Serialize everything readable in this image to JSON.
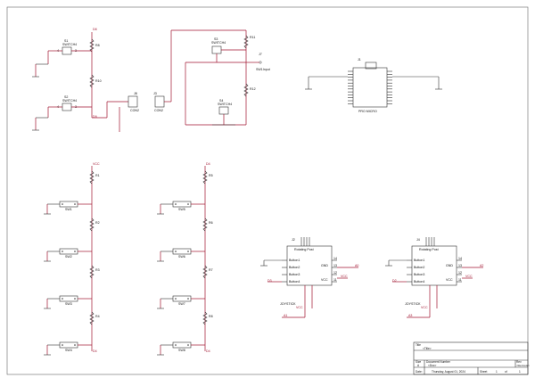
{
  "top": {
    "switches": [
      {
        "ref": "S1",
        "type": "SWITCH4"
      },
      {
        "ref": "S2",
        "type": "SWITCH4"
      },
      {
        "ref": "S3",
        "type": "SWITCH4"
      },
      {
        "ref": "S4",
        "type": "SWITCH4"
      }
    ],
    "resistors": [
      "R8",
      "R10",
      "R11",
      "R12"
    ],
    "con2_a": {
      "ref": "J8",
      "name": "CON2"
    },
    "con2_b": {
      "ref": "J3",
      "name": "CON2"
    },
    "pin1": {
      "ref": "J7",
      "name": "SW1Input"
    },
    "nets": {
      "a": "D8",
      "b": "D9",
      "c": "D9"
    }
  },
  "mcu": {
    "ref": "J1",
    "name": "PRO MICRO"
  },
  "grid": {
    "left": {
      "vcc": "VCC",
      "rows": [
        {
          "r": "R1",
          "sw": "SW1"
        },
        {
          "r": "R2",
          "sw": "SW2"
        },
        {
          "r": "R3",
          "sw": "SW3"
        },
        {
          "r": "R4",
          "sw": "SW4"
        }
      ],
      "bottom": "D4"
    },
    "right": {
      "vcc": "D4",
      "rows": [
        {
          "r": "R5",
          "sw": "SW5"
        },
        {
          "r": "R6",
          "sw": "SW6"
        },
        {
          "r": "R7",
          "sw": "SW7"
        },
        {
          "r": "R8",
          "sw": "SW8"
        }
      ],
      "bottom": "D4"
    }
  },
  "joysticks": [
    {
      "ref": "J2",
      "name": "JOYSTICK",
      "header": "Rotating Post",
      "pins_left": [
        "Button1",
        "Button2",
        "Button3",
        "Button4"
      ],
      "pins_right": [
        "14",
        "13",
        "12",
        "11"
      ],
      "right_labels": [
        "GND",
        "VCC"
      ],
      "nets": {
        "left": "D3",
        "right": "A0",
        "bottom": "A1",
        "vcc": "VCC"
      }
    },
    {
      "ref": "J4",
      "name": "JOYSTICK",
      "header": "Rotating Post",
      "pins_left": [
        "Button1",
        "Button2",
        "Button3",
        "Button4"
      ],
      "pins_right": [
        "14",
        "13",
        "12",
        "11"
      ],
      "right_labels": [
        "GND",
        "VCC"
      ],
      "nets": {
        "left": "D2",
        "right": "A2",
        "bottom": "A3",
        "vcc": "VCC"
      }
    }
  ],
  "title_block": {
    "title_label": "Title",
    "title": "<Title>",
    "size_label": "Size",
    "size": "A",
    "docnum_label": "Document Number",
    "docnum": "<Doc>",
    "rev_label": "Rev",
    "rev": "<RevCode>",
    "date_label": "Date:",
    "date": "Thursday, August 01, 2024",
    "sheet_label": "Sheet",
    "sheet_num": "1",
    "sheet_of": "of",
    "sheet_total": "1"
  }
}
